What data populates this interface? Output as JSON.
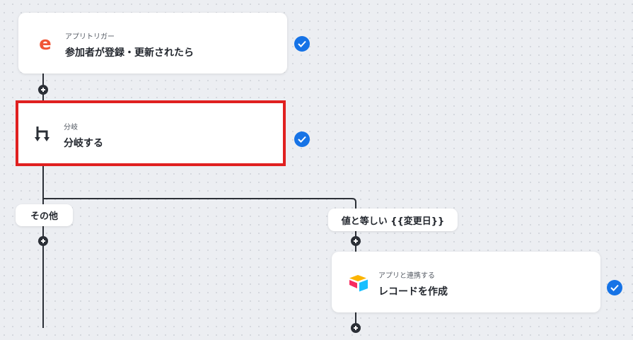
{
  "nodes": [
    {
      "subtitle": "アプリトリガー",
      "title": "参加者が登録・更新されたら",
      "icon": "eventbrite-e-icon",
      "status": "completed"
    },
    {
      "subtitle": "分岐",
      "title": "分岐する",
      "icon": "branch-icon",
      "status": "completed"
    },
    {
      "subtitle": "アプリと連携する",
      "title": "レコードを作成",
      "icon": "airtable-icon",
      "status": "completed"
    }
  ],
  "branches": {
    "other_label": "その他",
    "condition_label": "値と等しい {{変更日}}"
  },
  "colors": {
    "accent": "#1673e6",
    "highlight": "#e02020",
    "eventbrite": "#f05537"
  }
}
